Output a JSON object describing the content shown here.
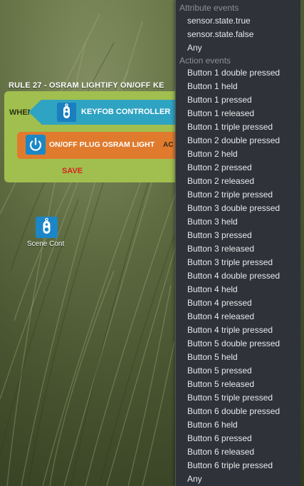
{
  "rule": {
    "title": "RULE 27 - OSRAM LIGHTIFY ON/OFF KE",
    "when_label": "WHEN",
    "trigger_label": "KEYFOB CONTROLLER",
    "action_label": "ON/OFF PLUG OSRAM LIGHT",
    "action_suffix": "AC",
    "save_label": "SAVE"
  },
  "palette": {
    "scene_label": "Scene Cont"
  },
  "dropdown": {
    "attribute_header": "Attribute events",
    "attribute_options": [
      "sensor.state.true",
      "sensor.state.false",
      "Any"
    ],
    "action_header": "Action events",
    "action_options": [
      "Button 1 double pressed",
      "Button 1 held",
      "Button 1 pressed",
      "Button 1 released",
      "Button 1 triple pressed",
      "Button 2 double pressed",
      "Button 2 held",
      "Button 2 pressed",
      "Button 2 released",
      "Button 2 triple pressed",
      "Button 3 double pressed",
      "Button 3 held",
      "Button 3 pressed",
      "Button 3 released",
      "Button 3 triple pressed",
      "Button 4 double pressed",
      "Button 4 held",
      "Button 4 pressed",
      "Button 4 released",
      "Button 4 triple pressed",
      "Button 5 double pressed",
      "Button 5 held",
      "Button 5 pressed",
      "Button 5 released",
      "Button 5 triple pressed",
      "Button 6 double pressed",
      "Button 6 held",
      "Button 6 pressed",
      "Button 6 released",
      "Button 6 triple pressed",
      "Any"
    ]
  },
  "icons": {
    "trigger": "keyfob-icon",
    "action": "power-icon",
    "scene": "keyfob-icon"
  },
  "colors": {
    "rule_block": "#a1bf4e",
    "trigger": "#2fa3c2",
    "action": "#e07b2e",
    "save": "#d62222",
    "dropdown_bg": "#2f3238"
  }
}
